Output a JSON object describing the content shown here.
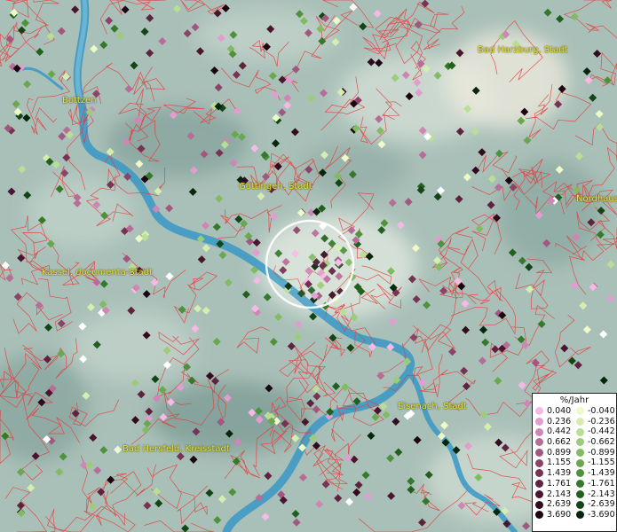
{
  "map": {
    "colors": {
      "terrain_light": "#dfe7df",
      "terrain_mid": "#a9c0b8",
      "terrain_dark": "#6f918b",
      "river": "#3a97c4",
      "boundary": "#e83a3a",
      "label": "#e8e23a"
    },
    "places": [
      {
        "name": "Bad Harzburg, Stadt"
      },
      {
        "name": "Bottzen"
      },
      {
        "name": "Göttingen, Stadt"
      },
      {
        "name": "Nordhaus"
      },
      {
        "name": "Kassel, documenta-Stadt"
      },
      {
        "name": "Eisenach, Stadt"
      },
      {
        "name": "Bad Hersfeld, Kreisstadt"
      }
    ],
    "search_circle": {
      "label": "selected-area"
    }
  },
  "legend": {
    "title": "%/Jahr",
    "rows": [
      {
        "pos": "0.040",
        "pos_color": "#f6b8e6",
        "neg": "-0.040",
        "neg_color": "#eefbc8"
      },
      {
        "pos": "0.236",
        "pos_color": "#e39ccf",
        "neg": "-0.236",
        "neg_color": "#d5eeb0"
      },
      {
        "pos": "0.442",
        "pos_color": "#cf86b4",
        "neg": "-0.442",
        "neg_color": "#b9df94"
      },
      {
        "pos": "0.662",
        "pos_color": "#b86c98",
        "neg": "-0.662",
        "neg_color": "#9dcc78"
      },
      {
        "pos": "0.899",
        "pos_color": "#a1577f",
        "neg": "-0.899",
        "neg_color": "#83bb62"
      },
      {
        "pos": "1.155",
        "pos_color": "#8b4467",
        "neg": "-1.155",
        "neg_color": "#6aa84f"
      },
      {
        "pos": "1.439",
        "pos_color": "#763353",
        "neg": "-1.439",
        "neg_color": "#4f923c"
      },
      {
        "pos": "1.761",
        "pos_color": "#5f2340",
        "neg": "-1.761",
        "neg_color": "#357a2a"
      },
      {
        "pos": "2.143",
        "pos_color": "#4a162f",
        "neg": "-2.143",
        "neg_color": "#226020"
      },
      {
        "pos": "2.639",
        "pos_color": "#330b1f",
        "neg": "-2.639",
        "neg_color": "#134616"
      },
      {
        "pos": "3.690",
        "pos_color": "#1c0410",
        "neg": "-3.690",
        "neg_color": "#06270b"
      }
    ]
  }
}
